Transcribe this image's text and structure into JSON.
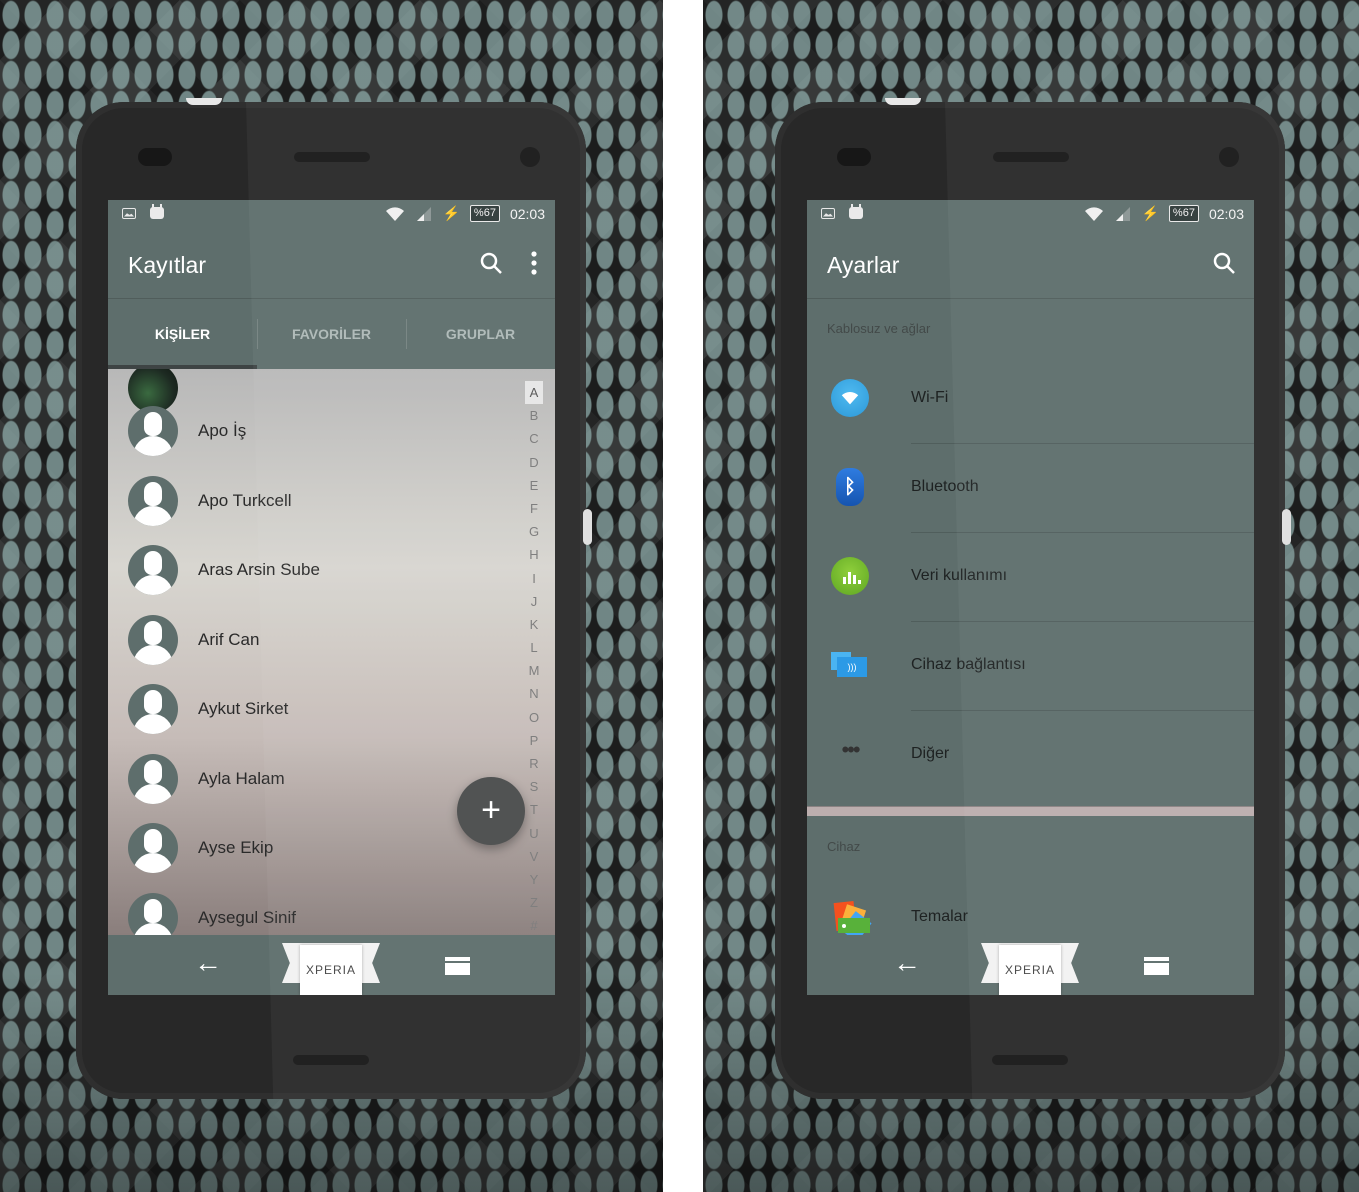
{
  "status_bar": {
    "battery": "%67",
    "time": "02:03",
    "left_icons": [
      "image-notification-icon",
      "android-bot-icon"
    ],
    "right_icons": [
      "wifi-icon",
      "cell-signal-icon",
      "charging-bolt-icon",
      "battery-icon"
    ]
  },
  "contacts_screen": {
    "title": "Kayıtlar",
    "actions": [
      "search-icon",
      "overflow-menu-icon"
    ],
    "tabs": [
      {
        "label": "KİŞİLER",
        "active": true
      },
      {
        "label": "FAVORİLER",
        "active": false
      },
      {
        "label": "GRUPLAR",
        "active": false
      }
    ],
    "contacts": [
      {
        "name": "Apo İş"
      },
      {
        "name": "Apo Turkcell"
      },
      {
        "name": "Aras Arsin Sube"
      },
      {
        "name": "Arif Can"
      },
      {
        "name": "Aykut Sirket"
      },
      {
        "name": "Ayla Halam"
      },
      {
        "name": "Ayse Ekip"
      },
      {
        "name": "Aysegul Sinif"
      }
    ],
    "alphabet_index": [
      "A",
      "B",
      "C",
      "D",
      "E",
      "F",
      "G",
      "H",
      "I",
      "J",
      "K",
      "L",
      "M",
      "N",
      "O",
      "P",
      "R",
      "S",
      "T",
      "U",
      "V",
      "Y",
      "Z",
      "#"
    ],
    "alphabet_selected": "A",
    "fab_label": "+"
  },
  "settings_screen": {
    "title": "Ayarlar",
    "actions": [
      "search-icon"
    ],
    "sections": [
      {
        "header": "Kablosuz ve ağlar",
        "items": [
          {
            "label": "Wi-Fi",
            "icon": "wifi-settings-icon"
          },
          {
            "label": "Bluetooth",
            "icon": "bluetooth-icon"
          },
          {
            "label": "Veri kullanımı",
            "icon": "data-usage-icon"
          },
          {
            "label": "Cihaz bağlantısı",
            "icon": "device-connection-icon"
          },
          {
            "label": "Diğer",
            "icon": "more-dots-icon"
          }
        ]
      },
      {
        "header": "Cihaz",
        "items": [
          {
            "label": "Temalar",
            "icon": "themes-icon"
          }
        ]
      }
    ]
  },
  "navbar": {
    "back_glyph": "←",
    "brand": "XPERIA"
  },
  "colors": {
    "theme": "#5e6e6c",
    "fab": "#4a4c4c"
  }
}
